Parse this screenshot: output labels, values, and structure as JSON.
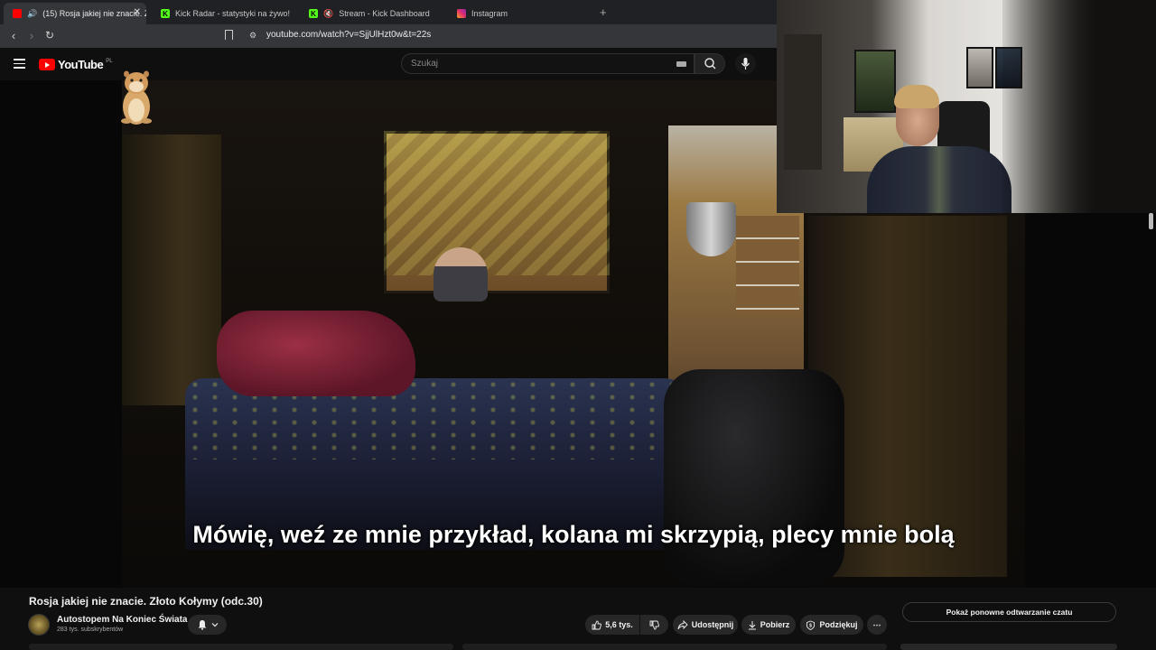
{
  "browser": {
    "tabs": [
      {
        "label": "(15) Rosja jakiej nie znacie. Złoto Kołymy (odc.30)",
        "favicon": "youtube-icon",
        "active": true
      },
      {
        "label": "Kick Radar - statystyki na żywo!",
        "favicon": "kick-icon"
      },
      {
        "label": "Stream - Kick Dashboard",
        "favicon": "kick-icon"
      },
      {
        "label": "Instagram",
        "favicon": "instagram-icon"
      }
    ],
    "new_tab_symbol": "+",
    "url": "youtube.com/watch?v=SjjUlHzt0w&t=22s"
  },
  "youtube": {
    "logo_text": "YouTube",
    "logo_region": "PL",
    "search_placeholder": "Szukaj"
  },
  "video": {
    "subtitle": "Mówię, weź ze mnie przykład, kolana mi skrzypią, plecy mnie bolą"
  },
  "info": {
    "title": "Rosja jakiej nie znacie. Złoto Kołymy (odc.30)",
    "channel": "Autostopem Na Koniec Świata",
    "subscribers": "283 tys. subskrybentów",
    "likes": "5,6 tys.",
    "share": "Udostępnij",
    "download": "Pobierz",
    "thanks": "Podziękuj",
    "more": "⋯",
    "chat_replay": "Pokaż ponowne odtwarzanie czatu"
  },
  "colors": {
    "youtube_red": "#ff0000",
    "kick_green": "#53fc18",
    "instagram": "#e1306c",
    "background": "#0f0f0f"
  }
}
